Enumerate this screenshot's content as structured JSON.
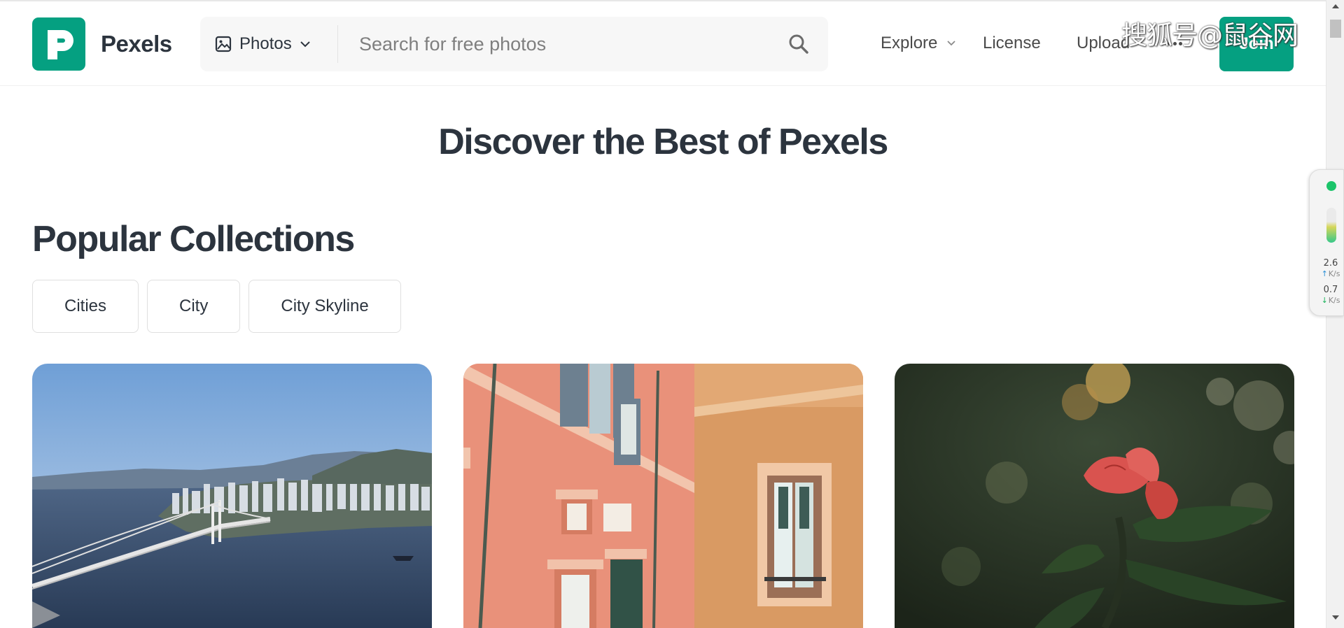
{
  "header": {
    "brand": "Pexels",
    "search": {
      "type_label": "Photos",
      "placeholder": "Search for free photos"
    },
    "nav": {
      "explore": "Explore",
      "license": "License",
      "upload": "Upload"
    },
    "join_label": "Join",
    "watermark": "搜狐号@鼠谷网"
  },
  "main": {
    "hero_title": "Discover the Best of Pexels",
    "section_title": "Popular Collections",
    "chips": [
      "Cities",
      "City",
      "City Skyline"
    ],
    "cards": [
      {
        "subject": "coastal city with suspension bridge"
      },
      {
        "subject": "salmon-colored building facade"
      },
      {
        "subject": "red flower with bokeh background"
      }
    ]
  },
  "speed_widget": {
    "upload_value": "2.6",
    "upload_unit": "K/s",
    "download_value": "0.7",
    "download_unit": "K/s"
  },
  "colors": {
    "brand": "#05a081",
    "text": "#2c343e",
    "search_bg": "#f7f7f7"
  },
  "icons": [
    "pexels-logo-icon",
    "image-icon",
    "chevron-down-icon",
    "search-icon",
    "more-dots-icon"
  ]
}
